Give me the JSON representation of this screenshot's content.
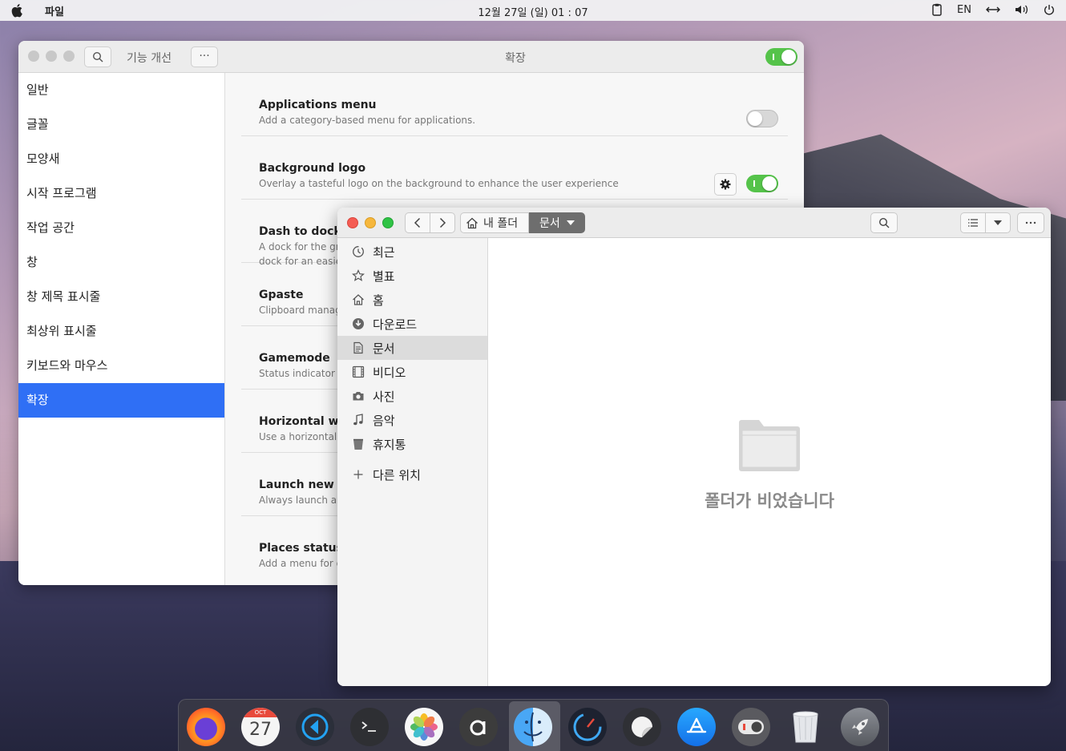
{
  "topbar": {
    "app_name": "파일",
    "clock": "12월 27일 (일) 01 : 07",
    "lang": "EN"
  },
  "settings": {
    "title_left": "기능 개선",
    "title_center": "확장",
    "more_label": "···",
    "sidebar": [
      {
        "label": "일반"
      },
      {
        "label": "글꼴"
      },
      {
        "label": "모양새"
      },
      {
        "label": "시작 프로그램"
      },
      {
        "label": "작업 공간"
      },
      {
        "label": "창"
      },
      {
        "label": "창 제목 표시줄"
      },
      {
        "label": "최상위 표시줄"
      },
      {
        "label": "키보드와 마우스"
      },
      {
        "label": "확장",
        "selected": true
      }
    ],
    "extensions": [
      {
        "title": "Applications menu",
        "desc": "Add a category-based menu for applications.",
        "desc2": "",
        "enabled": false
      },
      {
        "title": "Background logo",
        "desc": "Overlay a tasteful logo on the background to enhance the user experience",
        "desc2": "",
        "enabled": true
      },
      {
        "title": "Dash to dock",
        "desc": "A dock for the gnome shell. This extension moves the",
        "desc2": "dock for an easier launching of applications and a faster",
        "enabled": true
      },
      {
        "title": "Gpaste",
        "desc": "Clipboard management system",
        "desc2": "",
        "enabled": true
      },
      {
        "title": "Gamemode",
        "desc": "Status indicator for GameMode",
        "desc2": "",
        "enabled": true
      },
      {
        "title": "Horizontal workspaces",
        "desc": "Use a horizontal workspace layout",
        "desc2": "",
        "enabled": true
      },
      {
        "title": "Launch new instance",
        "desc": "Always launch a new instance when clicking in the dash",
        "desc2": "",
        "enabled": true
      },
      {
        "title": "Places status indicator",
        "desc": "Add a menu for quickly navigating places in the system",
        "desc2": "",
        "enabled": true
      }
    ]
  },
  "files": {
    "path_home": "내 폴더",
    "path_current": "문서",
    "sidebar": [
      {
        "label": "최근",
        "icon": "clock-icon"
      },
      {
        "label": "별표",
        "icon": "star-icon"
      },
      {
        "label": "홈",
        "icon": "home-icon"
      },
      {
        "label": "다운로드",
        "icon": "download-icon"
      },
      {
        "label": "문서",
        "icon": "document-icon",
        "selected": true
      },
      {
        "label": "비디오",
        "icon": "film-icon"
      },
      {
        "label": "사진",
        "icon": "camera-icon"
      },
      {
        "label": "음악",
        "icon": "music-icon"
      },
      {
        "label": "휴지통",
        "icon": "trash-icon"
      },
      {
        "label": "다른 위치",
        "icon": "plus-icon"
      }
    ],
    "empty_message": "폴더가 비었습니다"
  },
  "dock": {
    "calendar_month": "OCT",
    "calendar_day": "27",
    "items": [
      "firefox-icon",
      "calendar-icon",
      "vscode-icon",
      "terminal-icon",
      "photos-icon",
      "anbox-icon",
      "finder-icon",
      "speedometer-icon",
      "sticker-icon",
      "app-store-icon",
      "toggle-app-icon",
      "trash-icon",
      "launcher-icon"
    ]
  },
  "colors": {
    "accent": "#2f6ff5",
    "toggle_on": "#55c34a",
    "close": "#f45c53",
    "minimize": "#f6b73c",
    "maximize": "#2fc345"
  }
}
